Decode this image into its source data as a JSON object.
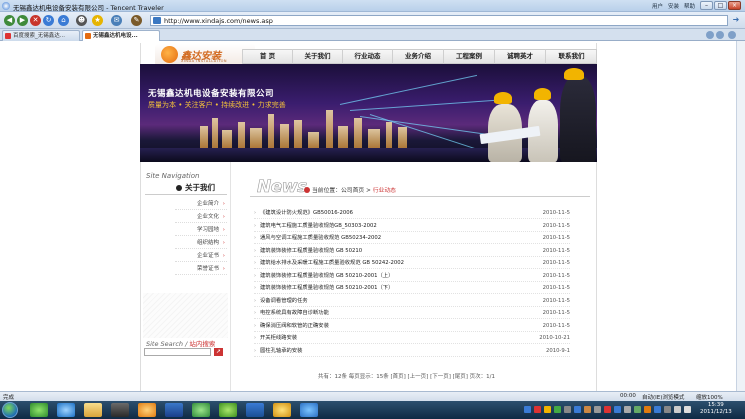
{
  "window": {
    "title": "无锡鑫达机电设备安装有限公司 - Tencent Traveler",
    "right_links": [
      "用户",
      "安装",
      "帮助"
    ]
  },
  "address": {
    "url": "http://www.xindajs.com/news.asp"
  },
  "tabs": [
    {
      "label": "百度搜索_无锡鑫达..."
    },
    {
      "label": "无锡鑫达机电设..."
    }
  ],
  "site": {
    "logo": {
      "text": "鑫达安装",
      "sub": "XINDA INSTALLATION"
    },
    "nav": [
      "首 页",
      "关于我们",
      "行业动态",
      "业务介绍",
      "工程案例",
      "诚聘英才",
      "联系我们"
    ],
    "banner": {
      "title": "无锡鑫达机电设备安装有限公司",
      "slogan": "质量为本 • 关注客户 • 持续改进 • 力求完善"
    },
    "sidebar": {
      "title": "Site Navigation",
      "subtitle": "关于我们",
      "links": [
        "企业简介",
        "企业文化",
        "学习园地",
        "组织结构",
        "企业证书",
        "荣誉证书"
      ],
      "search_title": "Site Search",
      "search_highlight": "站内搜索",
      "search_btn": "➚"
    },
    "content": {
      "heading": "News",
      "crumb_label": "当前位置：",
      "crumb_home": "公司首页",
      "crumb_sep": " > ",
      "crumb_current": "行业动态",
      "news": [
        {
          "title": "《建筑设计防火规范》GB50016-2006",
          "date": "2010-11-5"
        },
        {
          "title": "建筑电气工程施工质量验收规范GB_50303-2002",
          "date": "2010-11-5"
        },
        {
          "title": "通风与空调工程施工质量验收规范 GB50234-2002",
          "date": "2010-11-5"
        },
        {
          "title": "建筑装饰装修工程质量验收规范 GB 50210",
          "date": "2010-11-5"
        },
        {
          "title": "建筑给水排水及采暖工程施工质量验收规范 GB 50242-2002",
          "date": "2010-11-5"
        },
        {
          "title": "建筑装饰装修工程质量验收规范 GB 50210-2001（上）",
          "date": "2010-11-5"
        },
        {
          "title": "建筑装饰装修工程质量验收规范 GB 50210-2001（下）",
          "date": "2010-11-5"
        },
        {
          "title": "设备调看管理的任务",
          "date": "2010-11-5"
        },
        {
          "title": "电控系统具有故障自诊断功能",
          "date": "2010-11-5"
        },
        {
          "title": "确保消压阀和软管的正确安装",
          "date": "2010-11-5"
        },
        {
          "title": "开关柜线路安装",
          "date": "2010-10-21"
        },
        {
          "title": "圆柱孔轴承的安装",
          "date": "2010-9-1"
        }
      ],
      "pager": "共有：12条  每页显示：15条    [首页] [上一页] [下一页] [尾页]    页次：1/1"
    }
  },
  "statusbar": {
    "left": "完成",
    "time": "00:00",
    "mode": "自动(IE)浏览模式",
    "zoom": "缩放100%"
  },
  "clock": {
    "time": "15:39",
    "date": "2011/12/13"
  },
  "colors": {
    "brand": "#d2691e",
    "accent": "#cc3333",
    "titlebar": "#cfe0f2",
    "taskbar": "#0f2a44"
  }
}
